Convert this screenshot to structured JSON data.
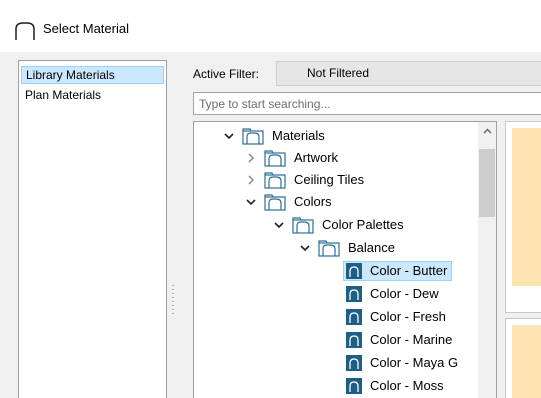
{
  "window": {
    "title": "Select Material",
    "title_icon": "arch-icon"
  },
  "library_panel": {
    "items": [
      {
        "label": "Library Materials",
        "selected": true
      },
      {
        "label": "Plan Materials",
        "selected": false
      }
    ]
  },
  "filter": {
    "label": "Active Filter:",
    "value": "Not Filtered"
  },
  "search": {
    "placeholder": "Type to start searching..."
  },
  "tree": {
    "rows": [
      {
        "label": "Materials",
        "level": 0,
        "expanded": true,
        "kind": "folder"
      },
      {
        "label": "Artwork",
        "level": 1,
        "expanded": false,
        "kind": "folder"
      },
      {
        "label": "Ceiling Tiles",
        "level": 1,
        "expanded": false,
        "kind": "folder"
      },
      {
        "label": "Colors",
        "level": 1,
        "expanded": true,
        "kind": "folder"
      },
      {
        "label": "Color Palettes",
        "level": 2,
        "expanded": true,
        "kind": "folder"
      },
      {
        "label": "Balance",
        "level": 3,
        "expanded": true,
        "kind": "folder"
      },
      {
        "label": "Color - Butter",
        "level": 4,
        "kind": "material",
        "selected": true
      },
      {
        "label": "Color - Dew",
        "level": 4,
        "kind": "material"
      },
      {
        "label": "Color - Fresh",
        "level": 4,
        "kind": "material"
      },
      {
        "label": "Color - Marine",
        "level": 4,
        "kind": "material"
      },
      {
        "label": "Color - Maya G",
        "level": 4,
        "kind": "material"
      },
      {
        "label": "Color - Moss",
        "level": 4,
        "kind": "material"
      }
    ]
  },
  "preview": {
    "swatch_color": "#fde5b4"
  },
  "colors": {
    "selection_fill": "#cce8ff",
    "selection_border": "#99d1ff",
    "material_icon": "#1e5f86",
    "folder_icon": "#2e6e95"
  }
}
